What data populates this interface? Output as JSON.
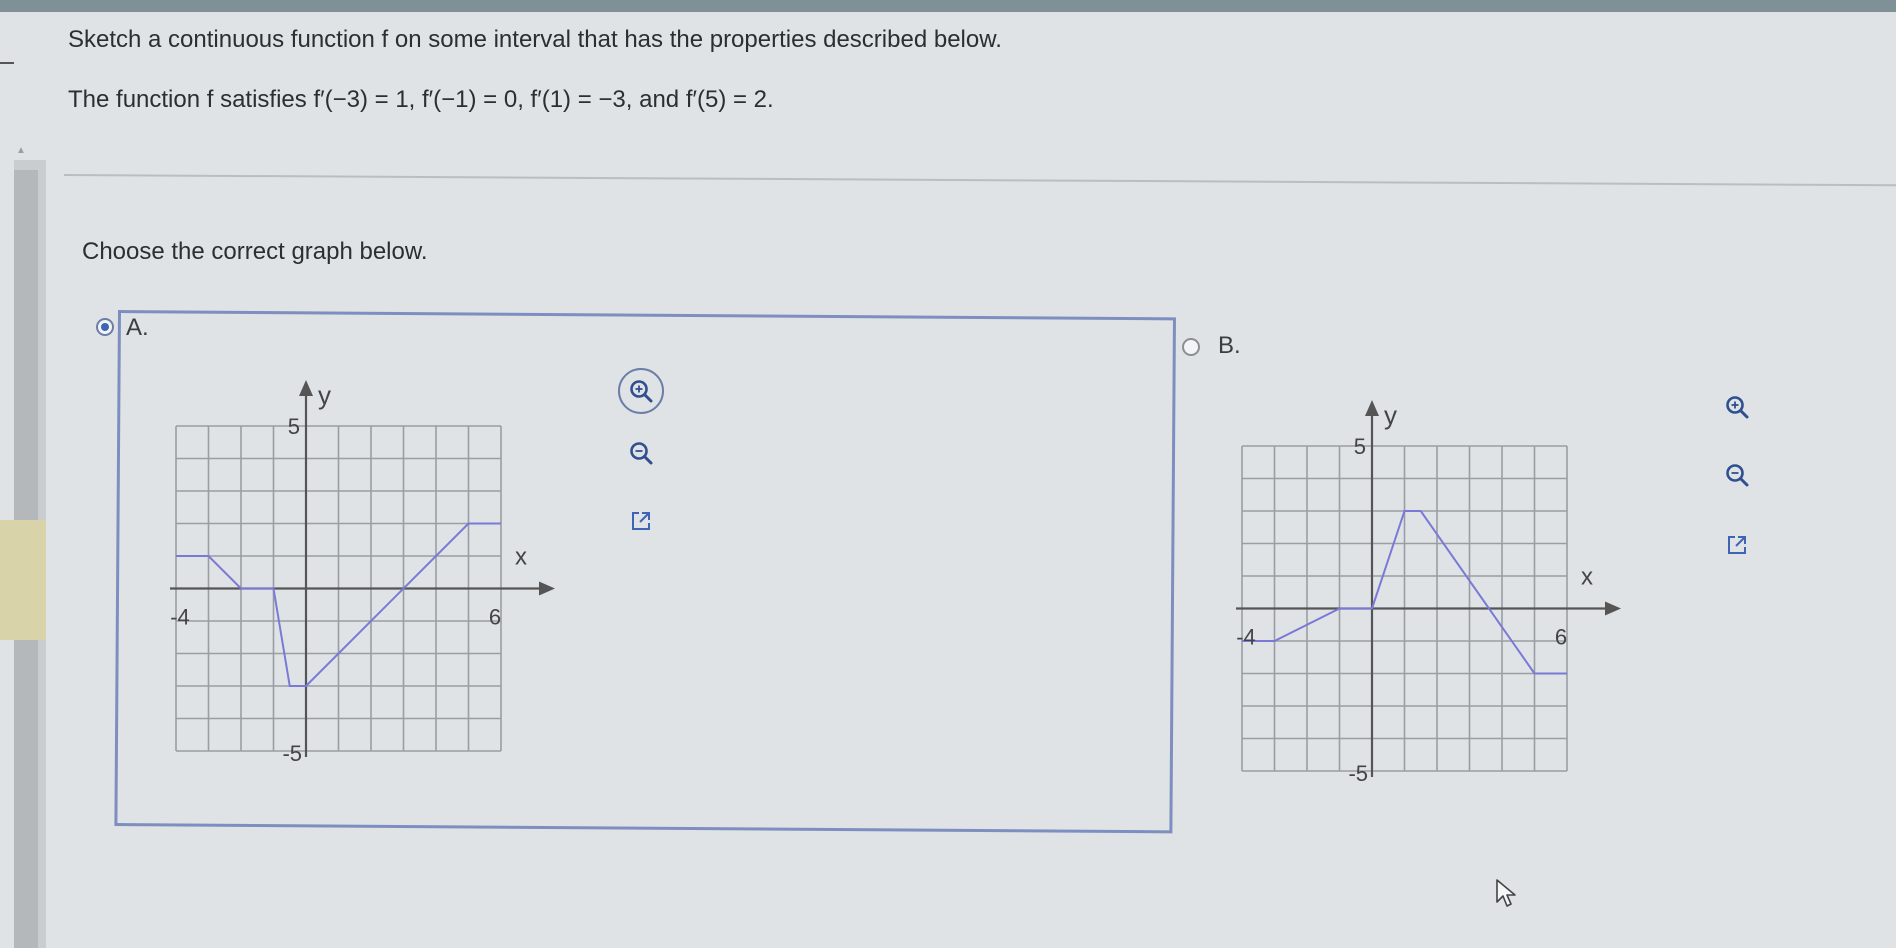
{
  "question": {
    "prompt": "Sketch a continuous function f on some interval that has the properties described below.",
    "conditions": "The function f satisfies f′(−3) = 1, f′(−1) = 0, f′(1) = −3, and f′(5) = 2.",
    "instruction": "Choose the correct graph below."
  },
  "options": [
    {
      "letter": "A.",
      "selected": true
    },
    {
      "letter": "B.",
      "selected": false
    }
  ],
  "graph_a": {
    "y_label": "y",
    "x_label": "x",
    "y_top": "5",
    "y_bottom": "-5",
    "x_left": "-4",
    "x_right": "6",
    "points": [
      [
        -4,
        1
      ],
      [
        -3,
        1
      ],
      [
        -2,
        0
      ],
      [
        -1,
        0
      ],
      [
        -0.5,
        -3
      ],
      [
        0,
        -3
      ],
      [
        5,
        2
      ],
      [
        6,
        2
      ]
    ]
  },
  "graph_b": {
    "y_label": "y",
    "x_label": "x",
    "y_top": "5",
    "y_bottom": "-5",
    "x_left": "-4",
    "x_right": "6",
    "points": [
      [
        -4,
        -1
      ],
      [
        -3,
        -1
      ],
      [
        -1,
        0
      ],
      [
        0,
        0
      ],
      [
        1,
        3
      ],
      [
        1.5,
        3
      ],
      [
        5,
        -2
      ],
      [
        6,
        -2
      ]
    ]
  },
  "tools": {
    "zoom_in": "zoom-in-icon",
    "zoom_out": "zoom-out-icon",
    "popout": "external-link-icon"
  },
  "colors": {
    "curve": "#7a7ad6",
    "accent": "#3f64b5",
    "grid": "#9a9ea2"
  }
}
